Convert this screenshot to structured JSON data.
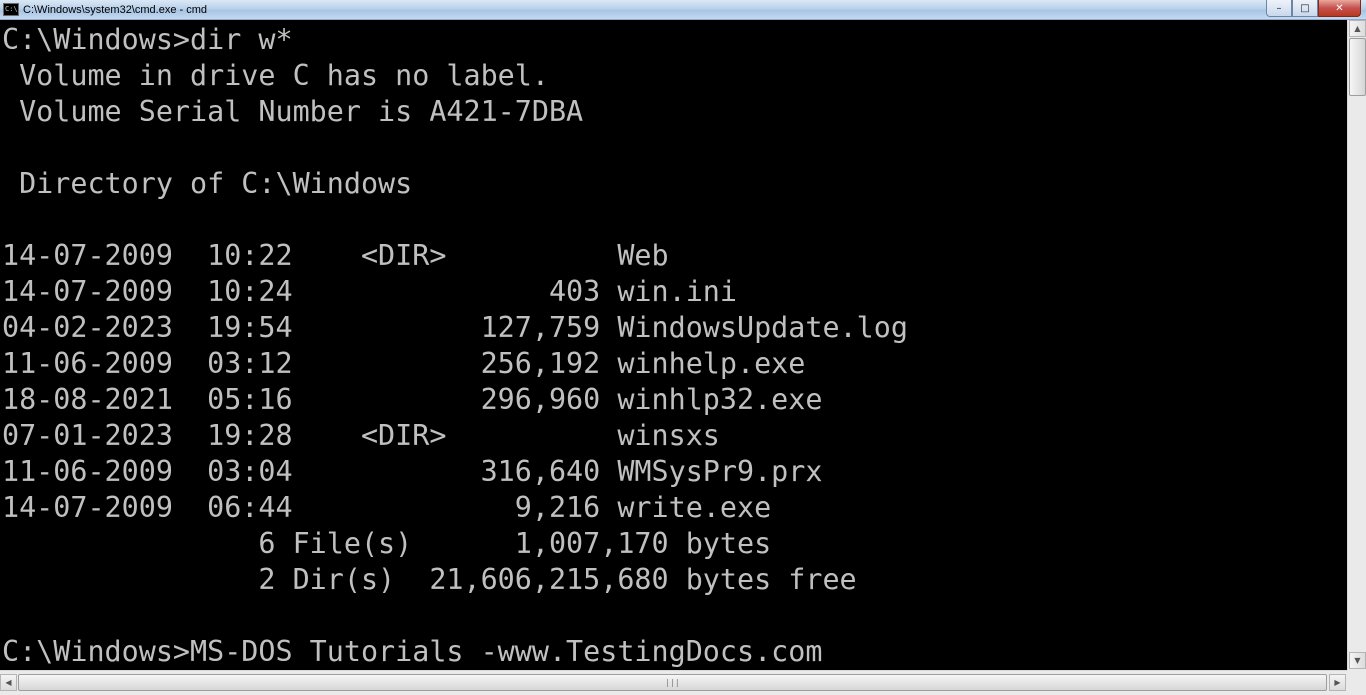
{
  "window": {
    "title": "C:\\Windows\\system32\\cmd.exe - cmd",
    "icon_text": "C:\\",
    "minimize_glyph": "–",
    "maximize_glyph": "□",
    "close_glyph": "✕"
  },
  "console": {
    "lines": [
      "C:\\Windows>dir w*",
      " Volume in drive C has no label.",
      " Volume Serial Number is A421-7DBA",
      "",
      " Directory of C:\\Windows",
      "",
      "14-07-2009  10:22    <DIR>          Web",
      "14-07-2009  10:24               403 win.ini",
      "04-02-2023  19:54           127,759 WindowsUpdate.log",
      "11-06-2009  03:12           256,192 winhelp.exe",
      "18-08-2021  05:16           296,960 winhlp32.exe",
      "07-01-2023  19:28    <DIR>          winsxs",
      "11-06-2009  03:04           316,640 WMSysPr9.prx",
      "14-07-2009  06:44             9,216 write.exe",
      "               6 File(s)      1,007,170 bytes",
      "               2 Dir(s)  21,606,215,680 bytes free",
      "",
      "C:\\Windows>MS-DOS Tutorials -www.TestingDocs.com"
    ]
  },
  "scrollbars": {
    "up_glyph": "▲",
    "down_glyph": "▼",
    "left_glyph": "◀",
    "right_glyph": "▶",
    "grip_glyph": "|||"
  },
  "colors": {
    "console_bg": "#000000",
    "console_fg": "#c0c0c0"
  }
}
